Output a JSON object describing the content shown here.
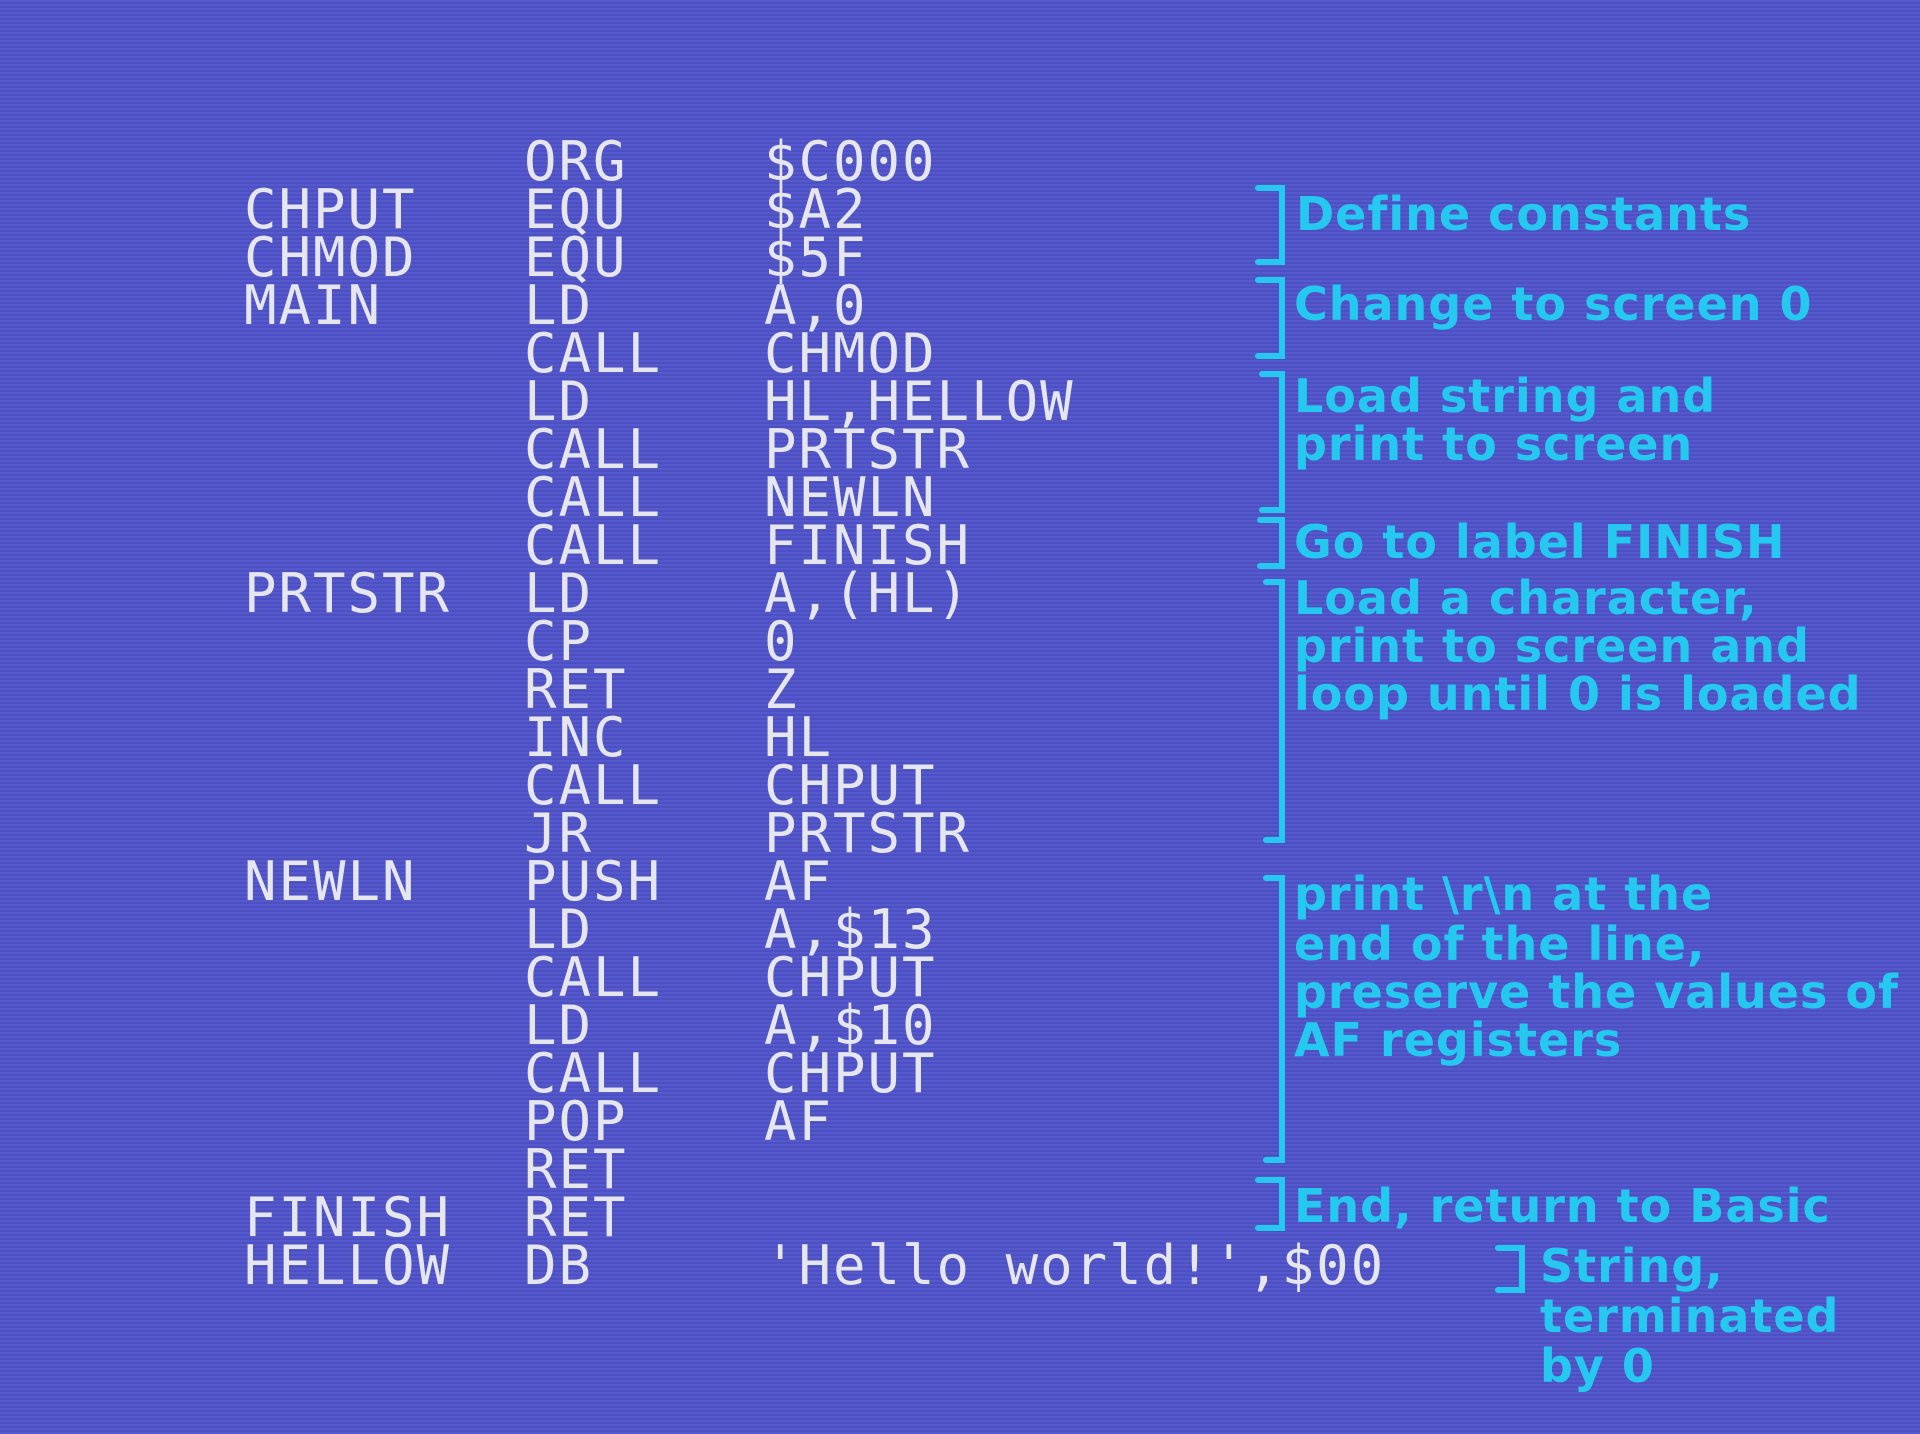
{
  "program": {
    "lines": [
      {
        "label": "",
        "op": "ORG",
        "arg": "$C000"
      },
      {
        "label": "CHPUT",
        "op": "EQU",
        "arg": "$A2"
      },
      {
        "label": "CHMOD",
        "op": "EQU",
        "arg": "$5F"
      },
      {
        "label": "MAIN",
        "op": "LD",
        "arg": "A,0"
      },
      {
        "label": "",
        "op": "CALL",
        "arg": "CHMOD"
      },
      {
        "label": "",
        "op": "LD",
        "arg": "HL,HELLOW"
      },
      {
        "label": "",
        "op": "CALL",
        "arg": "PRTSTR"
      },
      {
        "label": "",
        "op": "CALL",
        "arg": "NEWLN"
      },
      {
        "label": "",
        "op": "CALL",
        "arg": "FINISH"
      },
      {
        "label": "PRTSTR",
        "op": "LD",
        "arg": "A,(HL)"
      },
      {
        "label": "",
        "op": "CP",
        "arg": "0"
      },
      {
        "label": "",
        "op": "RET",
        "arg": "Z"
      },
      {
        "label": "",
        "op": "INC",
        "arg": "HL"
      },
      {
        "label": "",
        "op": "CALL",
        "arg": "CHPUT"
      },
      {
        "label": "",
        "op": "JR",
        "arg": "PRTSTR"
      },
      {
        "label": "NEWLN",
        "op": "PUSH",
        "arg": "AF"
      },
      {
        "label": "",
        "op": "LD",
        "arg": "A,$13"
      },
      {
        "label": "",
        "op": "CALL",
        "arg": "CHPUT"
      },
      {
        "label": "",
        "op": "LD",
        "arg": "A,$10"
      },
      {
        "label": "",
        "op": "CALL",
        "arg": "CHPUT"
      },
      {
        "label": "",
        "op": "POP",
        "arg": "AF"
      },
      {
        "label": "",
        "op": "RET",
        "arg": ""
      },
      {
        "label": "FINISH",
        "op": "RET",
        "arg": ""
      },
      {
        "label": "HELLOW",
        "op": "DB",
        "arg": "'Hello world!',$00"
      }
    ]
  },
  "annotations": {
    "define_constants": "Define constants",
    "change_screen": "Change to screen 0",
    "load_string_1": "Load string and",
    "load_string_2": "print to screen",
    "go_finish": "Go to label FINISH",
    "load_char_1": "Load a character,",
    "load_char_2": "print to screen and",
    "load_char_3": "loop until 0 is loaded",
    "newline_1": "print \\r\\n at the",
    "newline_2": "end of the line,",
    "newline_3": "preserve the values of",
    "newline_4": "AF registers",
    "end": "End, return to Basic",
    "string_1": "String,",
    "string_2": "terminated",
    "string_3": "by 0"
  },
  "colors": {
    "background": "#4f53c9",
    "code_text": "#e6e6f0",
    "annotation": "#25c9f0"
  }
}
